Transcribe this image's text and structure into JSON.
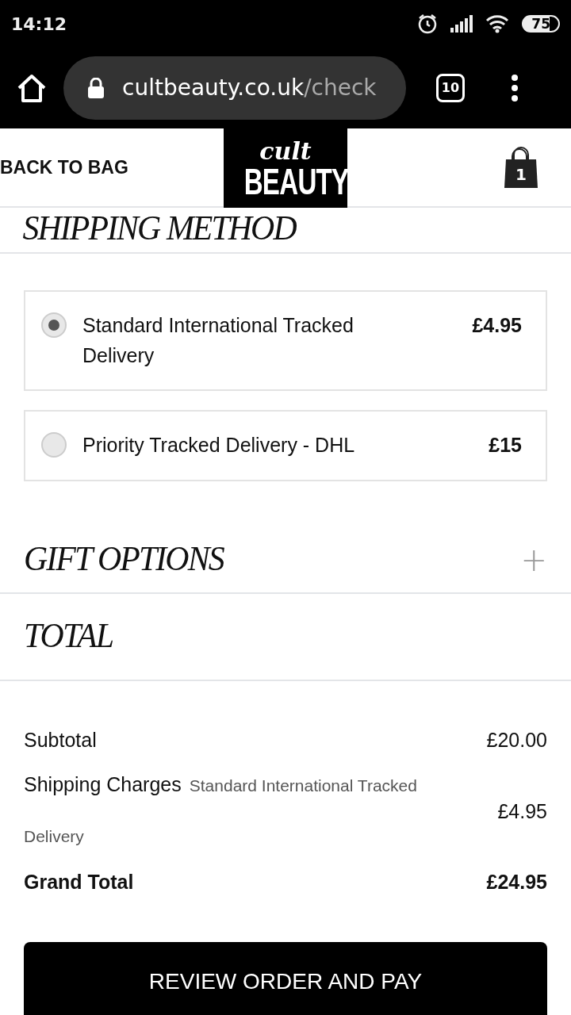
{
  "status_bar": {
    "time": "14:12",
    "battery": "75"
  },
  "browser": {
    "url_host": "cultbeauty.co.uk",
    "url_path": "/check",
    "tab_count": "10"
  },
  "header": {
    "back_link": "BACK TO BAG",
    "logo_top": "cult",
    "logo_bottom": "BEAUTY",
    "bag_count": "1"
  },
  "shipping": {
    "title": "SHIPPING METHOD",
    "options": [
      {
        "label": "Standard International Tracked Delivery",
        "price": "£4.95",
        "selected": true
      },
      {
        "label": "Priority Tracked Delivery - DHL",
        "price": "£15",
        "selected": false
      }
    ]
  },
  "gift_options": {
    "title": "GIFT OPTIONS",
    "toggle": "+",
    "expanded": false
  },
  "total": {
    "title": "TOTAL",
    "rows": [
      {
        "label": "Subtotal",
        "value": "£20.00",
        "kind": "plain"
      },
      {
        "label": "Shipping Charges",
        "note": "Standard International Tracked Delivery",
        "value": "£4.95",
        "kind": "note"
      },
      {
        "label": "Grand Total",
        "value": "£24.95",
        "kind": "grand"
      }
    ]
  },
  "checkout_button": "REVIEW ORDER AND PAY"
}
